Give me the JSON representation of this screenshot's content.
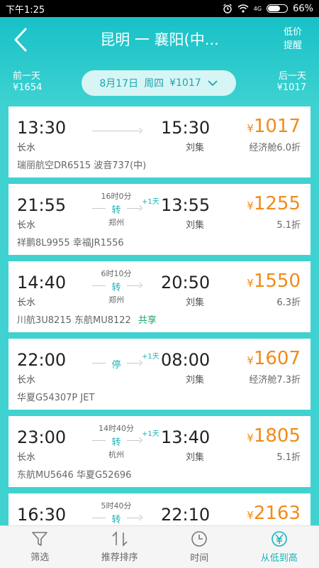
{
  "status_bar": {
    "time": "下午1:25",
    "battery": "66%",
    "net": "4G"
  },
  "header": {
    "title": "昆明 一 襄阳(中...",
    "alert_line1": "低价",
    "alert_line2": "提醒",
    "prev_label": "前一天",
    "prev_price": "¥1654",
    "next_label": "后一天",
    "next_price": "¥1017",
    "date": "8月17日",
    "weekday": "周四",
    "date_price": "¥1017"
  },
  "flights": [
    {
      "dep_time": "13:30",
      "dep_port": "长水",
      "arr_time": "15:30",
      "arr_port": "刘集",
      "price": "1017",
      "discount": "经济舱6.0折",
      "airline": "瑞丽航空DR6515 波音737(中)",
      "share": "",
      "duration": "",
      "mark": "",
      "city": "",
      "plus": ""
    },
    {
      "dep_time": "21:55",
      "dep_port": "长水",
      "arr_time": "13:55",
      "arr_port": "刘集",
      "price": "1255",
      "discount": "5.1折",
      "airline": "祥鹏8L9955 幸福JR1556",
      "share": "",
      "duration": "16时0分",
      "mark": "转",
      "city": "郑州",
      "plus": "+1天"
    },
    {
      "dep_time": "14:40",
      "dep_port": "长水",
      "arr_time": "20:50",
      "arr_port": "刘集",
      "price": "1550",
      "discount": "6.3折",
      "airline": "川航3U8215 东航MU8122",
      "share": "共享",
      "duration": "6时10分",
      "mark": "转",
      "city": "郑州",
      "plus": ""
    },
    {
      "dep_time": "22:00",
      "dep_port": "长水",
      "arr_time": "08:00",
      "arr_port": "刘集",
      "price": "1607",
      "discount": "经济舱7.3折",
      "airline": "华夏G54307P JET",
      "share": "",
      "duration": "",
      "mark": "停",
      "city": "",
      "plus": "+1天"
    },
    {
      "dep_time": "23:00",
      "dep_port": "长水",
      "arr_time": "13:40",
      "arr_port": "刘集",
      "price": "1805",
      "discount": "5.1折",
      "airline": "东航MU5646 华夏G52696",
      "share": "",
      "duration": "14时40分",
      "mark": "转",
      "city": "杭州",
      "plus": "+1天"
    },
    {
      "dep_time": "16:30",
      "dep_port": "",
      "arr_time": "22:10",
      "arr_port": "",
      "price": "2163",
      "discount": "",
      "airline": "",
      "share": "",
      "duration": "5时40分",
      "mark": "转",
      "city": "",
      "plus": ""
    }
  ],
  "currency": "¥",
  "tabs": [
    {
      "label": "筛选",
      "icon": "filter-icon"
    },
    {
      "label": "推荐排序",
      "icon": "sort-icon"
    },
    {
      "label": "时间",
      "icon": "clock-icon"
    },
    {
      "label": "从低到高",
      "icon": "yen-icon"
    }
  ],
  "colors": {
    "accent": "#17c1c7",
    "price": "#f08b1a"
  }
}
